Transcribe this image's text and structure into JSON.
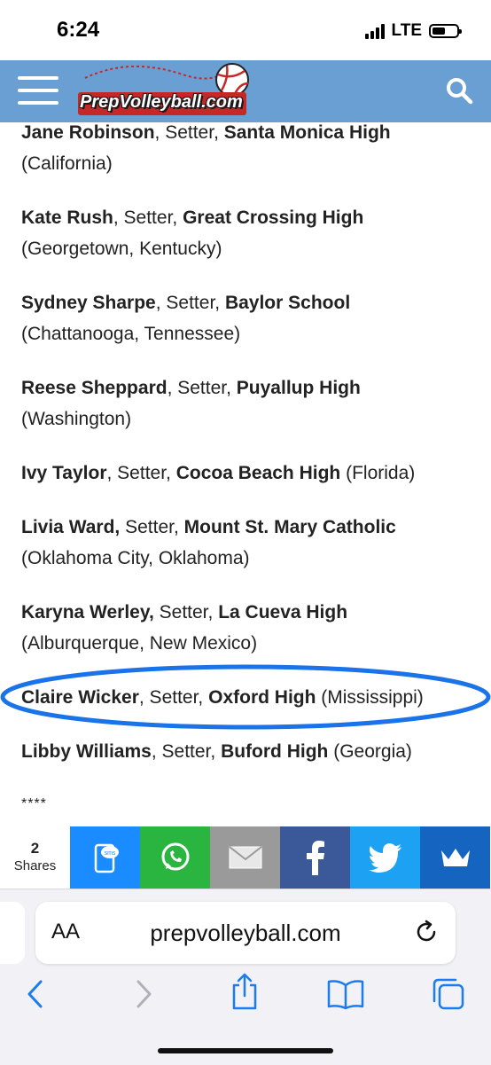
{
  "status_bar": {
    "time": "6:24",
    "network": "LTE"
  },
  "header": {
    "logo_text": "PrepVolleyball.com"
  },
  "entries": [
    {
      "name": "Jane Robinson",
      "sep1": ", Setter, ",
      "school": "Santa Monica High",
      "location": "(California)"
    },
    {
      "name": "Kate Rush",
      "sep1": ", Setter, ",
      "school": "Great Crossing High",
      "location": "(Georgetown, Kentucky)"
    },
    {
      "name": "Sydney Sharpe",
      "sep1": ", Setter, ",
      "school": "Baylor School",
      "location": "(Chattanooga, Tennessee)"
    },
    {
      "name": "Reese Sheppard",
      "sep1": ", Setter, ",
      "school": "Puyallup High",
      "location": "(Washington)"
    },
    {
      "name": "Ivy Taylor",
      "sep1": ", Setter, ",
      "school": "Cocoa Beach High",
      "location": "(Florida)"
    },
    {
      "name": "Livia Ward,",
      "sep1": " Setter, ",
      "school": "Mount St. Mary Catholic",
      "location": "(Oklahoma City, Oklahoma)"
    },
    {
      "name": "Karyna Werley,",
      "sep1": " Setter, ",
      "school": "La Cueva High",
      "location": "(Alburquerque, New Mexico)"
    },
    {
      "name": "Claire Wicker",
      "sep1": ", Setter, ",
      "school": "Oxford High",
      "location": "(Mississippi)"
    },
    {
      "name": "Libby Williams",
      "sep1": ", Setter, ",
      "school": "Buford High",
      "location": "(Georgia)"
    }
  ],
  "separator": "****",
  "share": {
    "count": "2",
    "label": "Shares",
    "colors": {
      "sms": "#1a8cff",
      "whatsapp": "#2ab540",
      "email": "#9a9a9a",
      "facebook": "#3b5998",
      "twitter": "#1da1f2",
      "crown": "#1565c0"
    }
  },
  "browser": {
    "text_size_label": "AA",
    "url": "prepvolleyball.com"
  },
  "colors": {
    "header": "#6a9fd4",
    "highlight": "#1a73e8"
  }
}
